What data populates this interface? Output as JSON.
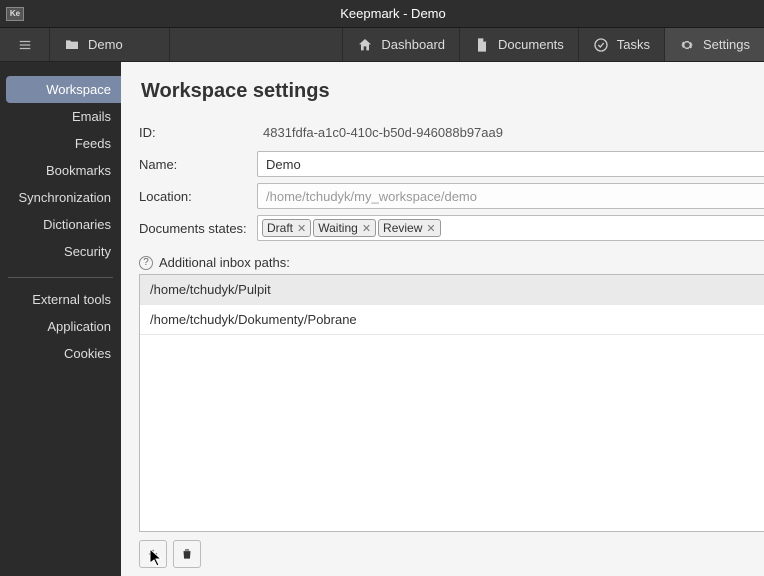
{
  "titlebar": {
    "app_icon_text": "Ke",
    "title": "Keepmark - Demo"
  },
  "toolbar": {
    "crumb": "Demo",
    "dashboard": "Dashboard",
    "documents": "Documents",
    "tasks": "Tasks",
    "settings": "Settings"
  },
  "sidebar": {
    "items": [
      "Workspace",
      "Emails",
      "Feeds",
      "Bookmarks",
      "Synchronization",
      "Dictionaries",
      "Security"
    ],
    "group2": [
      "External tools",
      "Application",
      "Cookies"
    ]
  },
  "page": {
    "title": "Workspace settings",
    "labels": {
      "id": "ID:",
      "name": "Name:",
      "location": "Location:",
      "states": "Documents states:",
      "additional_paths": "Additional inbox paths:"
    },
    "id_value": "4831fdfa-a1c0-410c-b50d-946088b97aa9",
    "name_value": "Demo",
    "location_value": "/home/tchudyk/my_workspace/demo",
    "states": [
      "Draft",
      "Waiting",
      "Review"
    ],
    "inbox_paths": [
      "/home/tchudyk/Pulpit",
      "/home/tchudyk/Dokumenty/Pobrane"
    ]
  }
}
